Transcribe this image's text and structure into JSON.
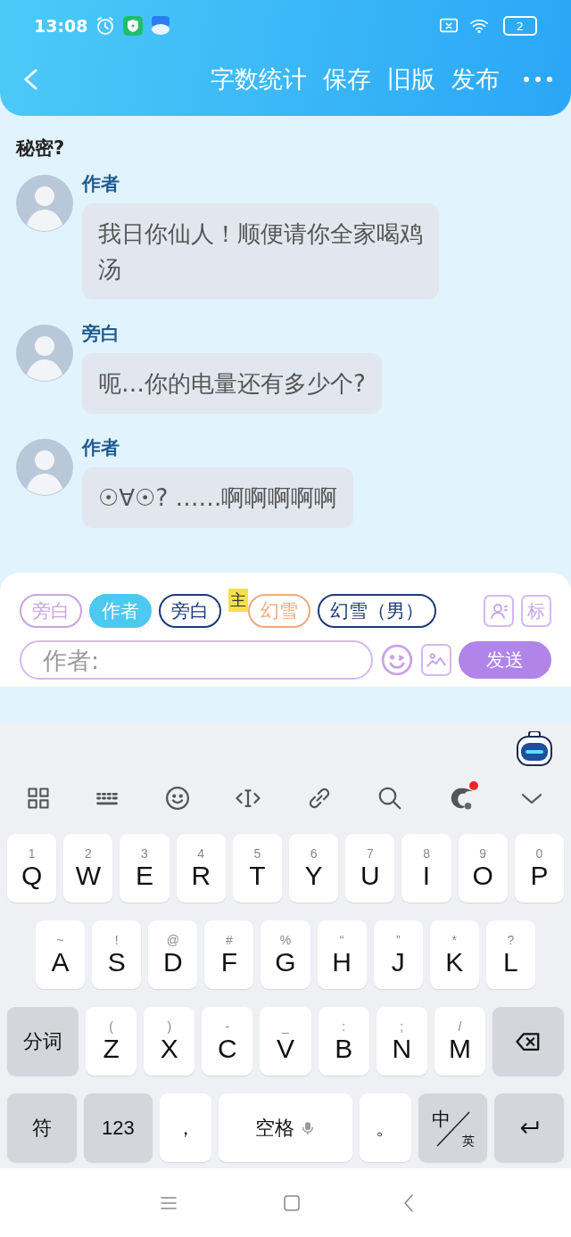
{
  "status_bar": {
    "time": "13:08",
    "battery": "2"
  },
  "header": {
    "actions": [
      "字数统计",
      "保存",
      "旧版",
      "发布"
    ]
  },
  "chat": {
    "title": "秘密?",
    "messages": [
      {
        "speaker": "作者",
        "text": "我日你仙人！顺便请你全家喝鸡汤"
      },
      {
        "speaker": "旁白",
        "text": "呃…你的电量还有多少个?"
      },
      {
        "speaker": "作者",
        "text": "☉∀☉? ……啊啊啊啊啊"
      }
    ]
  },
  "composer": {
    "roles": [
      {
        "label": "旁白",
        "selected": false,
        "color": "#c9a3e0"
      },
      {
        "label": "作者",
        "selected": true,
        "color": "#4dc8f0"
      },
      {
        "label": "旁白",
        "selected": false,
        "color": "#1b3a78"
      },
      {
        "label": "幻雪",
        "selected": false,
        "color": "#f0a878",
        "badge": "主"
      },
      {
        "label": "幻雪（男）",
        "selected": false,
        "color": "#1b3a78"
      }
    ],
    "tag_button": "标",
    "placeholder": "作者:",
    "send": "发送"
  },
  "keyboard": {
    "ai_notification": true,
    "rows": [
      {
        "keys": [
          {
            "kind": "letter",
            "main": "Q",
            "hint": "1"
          },
          {
            "kind": "letter",
            "main": "W",
            "hint": "2"
          },
          {
            "kind": "letter",
            "main": "E",
            "hint": "3"
          },
          {
            "kind": "letter",
            "main": "R",
            "hint": "4"
          },
          {
            "kind": "letter",
            "main": "T",
            "hint": "5"
          },
          {
            "kind": "letter",
            "main": "Y",
            "hint": "6"
          },
          {
            "kind": "letter",
            "main": "U",
            "hint": "7"
          },
          {
            "kind": "letter",
            "main": "I",
            "hint": "8"
          },
          {
            "kind": "letter",
            "main": "O",
            "hint": "9"
          },
          {
            "kind": "letter",
            "main": "P",
            "hint": "0"
          }
        ]
      },
      {
        "keys": [
          {
            "kind": "letter",
            "main": "A",
            "hint": "~"
          },
          {
            "kind": "letter",
            "main": "S",
            "hint": "!"
          },
          {
            "kind": "letter",
            "main": "D",
            "hint": "@"
          },
          {
            "kind": "letter",
            "main": "F",
            "hint": "#"
          },
          {
            "kind": "letter",
            "main": "G",
            "hint": "%"
          },
          {
            "kind": "letter",
            "main": "H",
            "hint": "“"
          },
          {
            "kind": "letter",
            "main": "J",
            "hint": "”"
          },
          {
            "kind": "letter",
            "main": "K",
            "hint": "*"
          },
          {
            "kind": "letter",
            "main": "L",
            "hint": "?"
          }
        ]
      },
      {
        "keys": [
          {
            "kind": "function",
            "main": "分词"
          },
          {
            "kind": "letter",
            "main": "Z",
            "hint": "("
          },
          {
            "kind": "letter",
            "main": "X",
            "hint": ")"
          },
          {
            "kind": "letter",
            "main": "C",
            "hint": "-"
          },
          {
            "kind": "letter",
            "main": "V",
            "hint": "_"
          },
          {
            "kind": "letter",
            "main": "B",
            "hint": ":"
          },
          {
            "kind": "letter",
            "main": "N",
            "hint": ";"
          },
          {
            "kind": "letter",
            "main": "M",
            "hint": "/"
          },
          {
            "kind": "backspace"
          }
        ]
      },
      {
        "keys": [
          {
            "kind": "function",
            "main": "符"
          },
          {
            "kind": "function",
            "main": "123"
          },
          {
            "kind": "punct",
            "main": "，"
          },
          {
            "kind": "space",
            "main": "空格"
          },
          {
            "kind": "punct",
            "main": "。"
          },
          {
            "kind": "lang",
            "main": "中",
            "sub": "英"
          },
          {
            "kind": "enter"
          }
        ]
      }
    ]
  }
}
